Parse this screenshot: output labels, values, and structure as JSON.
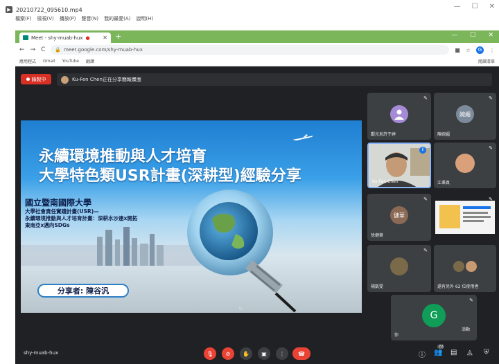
{
  "player": {
    "title": "20210722_095610.mp4",
    "menu": [
      "檔案(F)",
      "檢視(V)",
      "播放(P)",
      "聲音(N)",
      "我的最愛(A)",
      "說明(H)"
    ],
    "controls": [
      "—",
      "☐",
      "✕"
    ]
  },
  "browser": {
    "tab_title": "Meet - shy-muab-hux",
    "url": "meet.google.com/shy-muab-hux",
    "bookmarks": [
      "應用程式",
      "Gmail",
      "YouTube",
      "翻譯"
    ],
    "bookmarks_right": "閱讀清單",
    "profile_initial": "G"
  },
  "meet": {
    "recording_label": "錄製中",
    "present_banner": "Ku-Fen Chen正在分享簡報畫面",
    "meeting_code": "shy-muab-hux",
    "people_count": "72",
    "tooltip": "活動",
    "colors": {
      "accent_red": "#ea4335",
      "bg": "#202124",
      "tile": "#3c4043",
      "chrome_green": "#6aa84f"
    }
  },
  "slide": {
    "title1": "永續環境推動與人才培育",
    "title2": "大學特色類USR計畫(深耕型)經驗分享",
    "org": "國立暨南國際大學",
    "lines": [
      "大學社會責任實踐計畫(USR)—",
      "永續環境推動與人才培育計畫：深耕水沙連x開拓",
      "東南亞x邁向SDGs"
    ],
    "speaker": "分享者: 陳谷汎"
  },
  "participants": [
    {
      "name": "觀光系許于婷",
      "avatar": "person-icon",
      "color": "#a58bd6"
    },
    {
      "name": "陳婉媚",
      "avatar": "婉媚",
      "color": "#7c8a9a"
    },
    {
      "name": "Ku-Fen Chen",
      "avatar": "video",
      "color": "#8a7a6a"
    },
    {
      "name": "江秉真",
      "avatar": "photo",
      "color": "#d9a07a"
    },
    {
      "name": "徐健華",
      "avatar": "健華",
      "color": "#8b6a55"
    },
    {
      "name": "",
      "avatar": "screen",
      "color": "#f4f4f4"
    },
    {
      "name": "楊凱雯",
      "avatar": "photo",
      "color": "#7a6a4a"
    },
    {
      "name": "還有另外 62 位使用者",
      "avatar": "group",
      "color": "#7a6a4a"
    },
    {
      "name": "你",
      "avatar": "G",
      "color": "#0f9d58"
    }
  ]
}
